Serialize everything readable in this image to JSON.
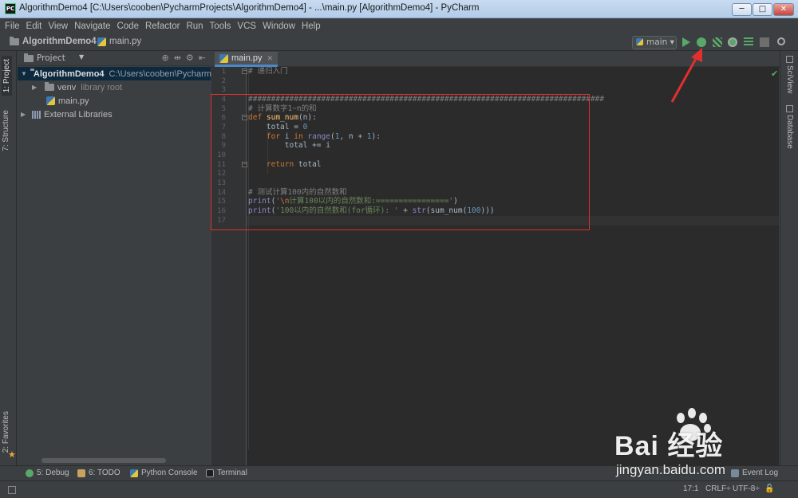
{
  "window": {
    "title": "AlgorithmDemo4 [C:\\Users\\cooben\\PycharmProjects\\AlgorithmDemo4] - ...\\main.py [AlgorithmDemo4] - PyCharm",
    "app_icon_text": "PC",
    "min_label": "─",
    "max_label": "□",
    "close_label": "✕"
  },
  "menu": [
    "File",
    "Edit",
    "View",
    "Navigate",
    "Code",
    "Refactor",
    "Run",
    "Tools",
    "VCS",
    "Window",
    "Help"
  ],
  "navbar": {
    "project": "AlgorithmDemo4",
    "file": "main.py",
    "run_config": "main"
  },
  "left_tabs": {
    "project": "1: Project",
    "structure": "7: Structure",
    "favorites": "2: Favorites"
  },
  "project_panel": {
    "header": "Project",
    "tree": [
      {
        "label": "AlgorithmDemo4",
        "hint": "C:\\Users\\cooben\\PycharmProjects"
      },
      {
        "label": "venv",
        "hint": "library root"
      },
      {
        "label": "main.py",
        "hint": ""
      },
      {
        "label": "External Libraries",
        "hint": ""
      }
    ]
  },
  "editor": {
    "tab": "main.py",
    "line_numbers": [
      "1",
      "2",
      "3",
      "4",
      "5",
      "6",
      "7",
      "8",
      "9",
      "10",
      "11",
      "12",
      "13",
      "14",
      "15",
      "16",
      "17"
    ],
    "lines": {
      "l1": "# 递归入门",
      "l4": "##############################################################################",
      "l5": "# 计算数字1~n的和",
      "l6_kw": "def ",
      "l6_fn": "sum_num",
      "l6_rest": "(n):",
      "l7_a": "    total = ",
      "l7_n": "0",
      "l8_kw1": "    for ",
      "l8_a": "i ",
      "l8_kw2": "in ",
      "l8_bi": "range",
      "l8_b": "(",
      "l8_n1": "1",
      "l8_c": ", n + ",
      "l8_n2": "1",
      "l8_d": "):",
      "l9": "        total += i",
      "l11_kw": "    return ",
      "l11_a": "total",
      "l14": "# 测试计算100内的自然数和",
      "l15_bi": "print",
      "l15_a": "(",
      "l15_s1": "'",
      "l15_esc": "\\n",
      "l15_s2": "计算100以内的自然数和:================'",
      "l15_b": ")",
      "l16_bi": "print",
      "l16_a": "(",
      "l16_s": "'100以内的自然数和(for循环): '",
      "l16_b": " + ",
      "l16_bi2": "str",
      "l16_c": "(sum_num(",
      "l16_n": "100",
      "l16_d": ")))"
    }
  },
  "right_tabs": {
    "sciview": "SciView",
    "database": "Database"
  },
  "bottom_tabs": {
    "debug": "5: Debug",
    "todo": "6: TODO",
    "console": "Python Console",
    "terminal": "Terminal",
    "event_log": "Event Log"
  },
  "status": {
    "position": "17:1",
    "line_sep": "CRLF÷",
    "encoding": "UTF-8÷"
  },
  "watermark": {
    "brand": "Bai  经验",
    "url": "jingyan.baidu.com"
  },
  "colors": {
    "accent_run": "#59a869",
    "highlight_box": "#e0302f"
  }
}
